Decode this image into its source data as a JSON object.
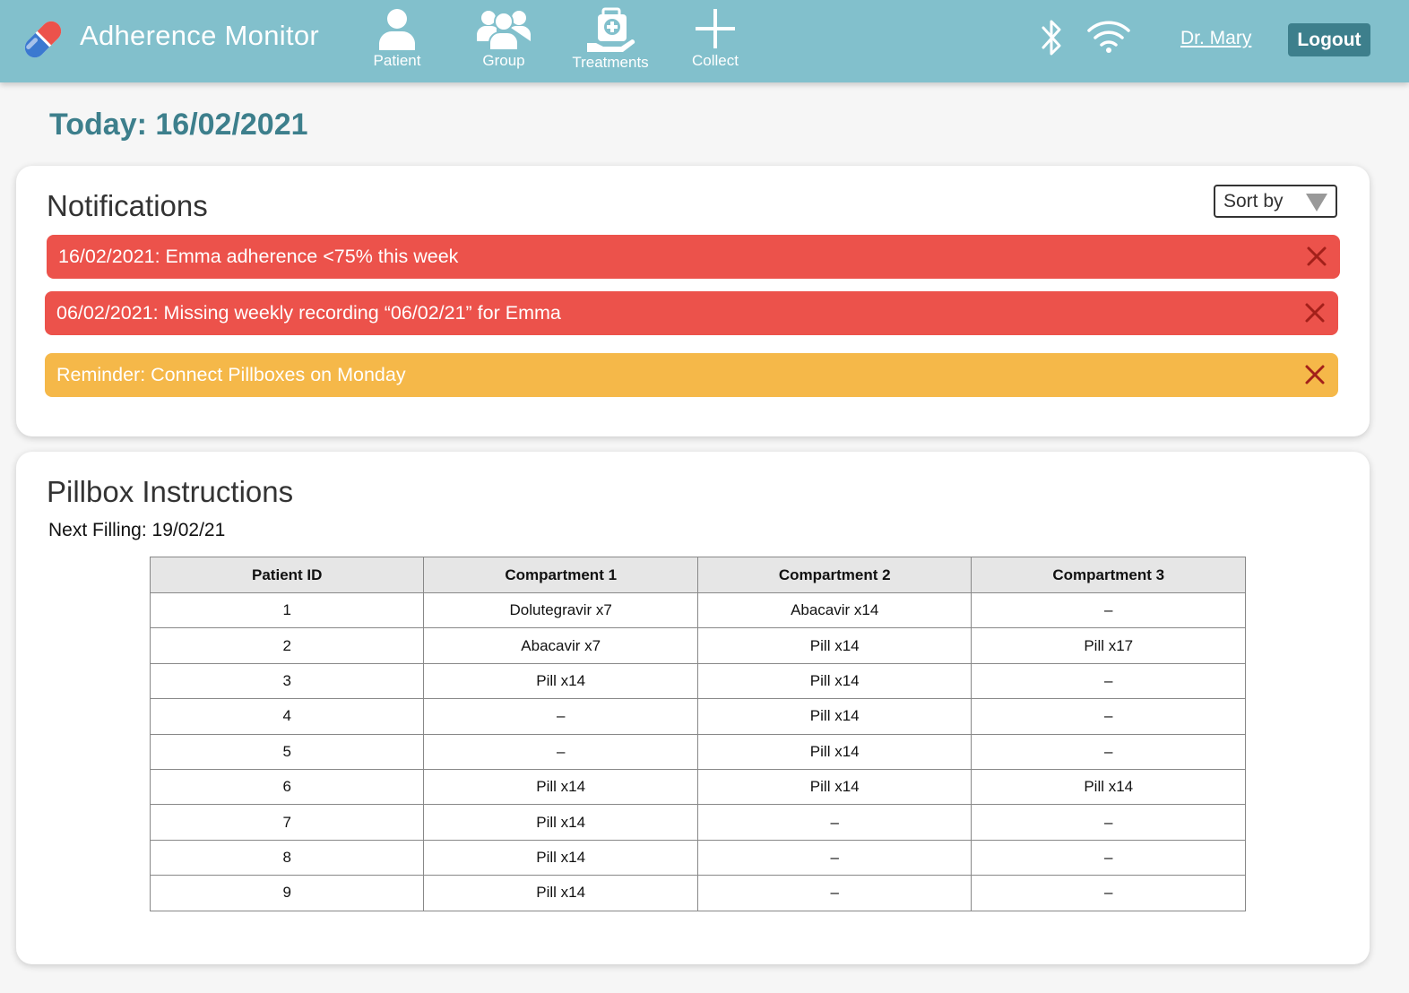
{
  "header": {
    "app_title": "Adherence Monitor",
    "nav": [
      {
        "label": "Patient",
        "icon": "person-icon"
      },
      {
        "label": "Group",
        "icon": "group-icon"
      },
      {
        "label": "Treatments",
        "icon": "medical-kit-icon"
      },
      {
        "label": "Collect",
        "icon": "plus-icon"
      }
    ],
    "user": "Dr. Mary",
    "logout_label": "Logout"
  },
  "today_label": "Today: 16/02/2021",
  "notifications": {
    "title": "Notifications",
    "sort_label": "Sort by",
    "items": [
      {
        "text": "16/02/2021: Emma adherence <75% this week",
        "level": "alert",
        "color": "#ec524b"
      },
      {
        "text": "06/02/2021: Missing weekly recording “06/02/21” for Emma",
        "level": "alert",
        "color": "#ec524b"
      },
      {
        "text": "Reminder: Connect Pillboxes on Monday",
        "level": "reminder",
        "color": "#f5b849"
      }
    ]
  },
  "pillbox": {
    "title": "Pillbox Instructions",
    "next_filling": "Next Filling: 19/02/21",
    "columns": [
      "Patient ID",
      "Compartment 1",
      "Compartment 2",
      "Compartment 3"
    ],
    "rows": [
      [
        "1",
        "Dolutegravir x7",
        "Abacavir x14",
        "–"
      ],
      [
        "2",
        "Abacavir x7",
        "Pill x14",
        "Pill x17"
      ],
      [
        "3",
        "Pill x14",
        "Pill x14",
        "–"
      ],
      [
        "4",
        "–",
        "Pill x14",
        "–"
      ],
      [
        "5",
        "–",
        "Pill x14",
        "–"
      ],
      [
        "6",
        "Pill x14",
        "Pill x14",
        "Pill x14"
      ],
      [
        "7",
        "Pill x14",
        "–",
        "–"
      ],
      [
        "8",
        "Pill x14",
        "–",
        "–"
      ],
      [
        "9",
        "Pill x14",
        "–",
        "–"
      ]
    ]
  },
  "colors": {
    "header_bg": "#82c0cc",
    "accent": "#3d7f8c",
    "alert_red": "#ec524b",
    "reminder_yellow": "#f5b849",
    "close_icon": "#a3201a"
  }
}
